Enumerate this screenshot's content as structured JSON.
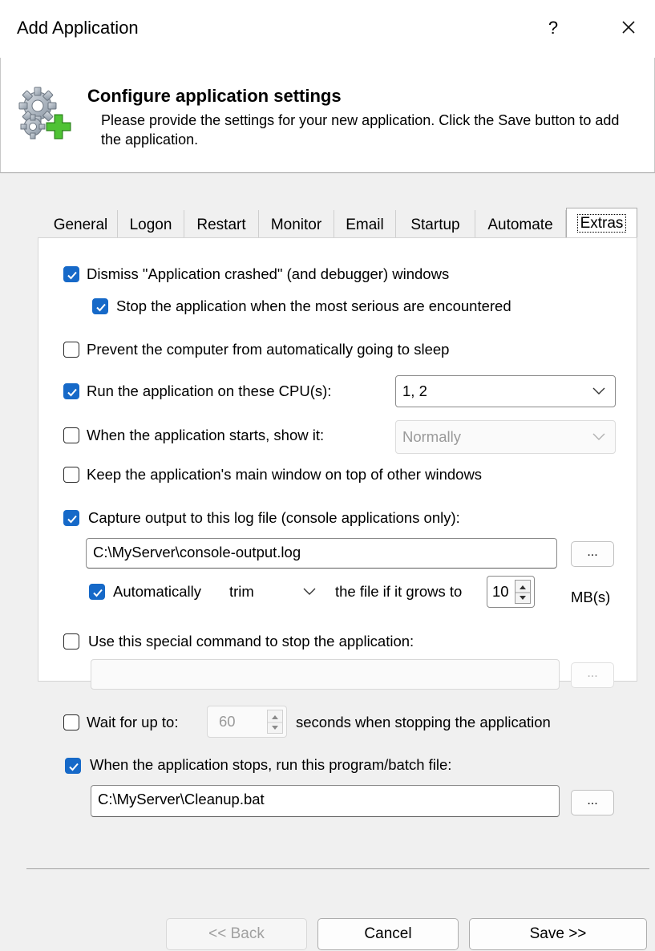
{
  "window": {
    "title": "Add Application",
    "help": "?",
    "close_icon": "close-icon"
  },
  "header": {
    "icon": "gears-add-icon",
    "title": "Configure application settings",
    "description": "Please provide the settings for your new application. Click the Save button to add the application."
  },
  "tabs": [
    "General",
    "Logon",
    "Restart",
    "Monitor",
    "Email",
    "Startup",
    "Automate",
    "Extras"
  ],
  "active_tab": "Extras",
  "options": {
    "dismiss_crashed": {
      "label": "Dismiss \"Application crashed\" (and debugger) windows",
      "checked": true
    },
    "stop_serious": {
      "label": "Stop the application when the most serious are encountered",
      "checked": true
    },
    "prevent_sleep": {
      "label": "Prevent the computer from automatically going to sleep",
      "checked": false
    },
    "run_cpus": {
      "label": "Run the application on these CPU(s):",
      "checked": true,
      "value": "1, 2"
    },
    "show_on_start": {
      "label": "When the application starts, show it:",
      "checked": false,
      "value": "Normally"
    },
    "keep_on_top": {
      "label": "Keep the application's main window on top of other windows",
      "checked": false
    },
    "capture_output": {
      "label": "Capture output to this log file (console applications only):",
      "checked": true,
      "path": "C:\\MyServer\\console-output.log",
      "browse": "..."
    },
    "auto_trim": {
      "label": "Automatically",
      "checked": true,
      "mode": "trim",
      "middle_text": "the file if it grows to",
      "size": "10",
      "unit": "MB(s)"
    },
    "special_stop": {
      "label": "Use this special command to stop the application:",
      "checked": false,
      "value": "",
      "browse": "..."
    },
    "wait_for": {
      "label": "Wait for up to:",
      "checked": false,
      "seconds": "60",
      "suffix": "seconds when stopping the application"
    },
    "run_on_stop": {
      "label": "When the application stops, run this program/batch file:",
      "checked": true,
      "path": "C:\\MyServer\\Cleanup.bat",
      "browse": "..."
    }
  },
  "buttons": {
    "back": "<< Back",
    "cancel": "Cancel",
    "save": "Save >>"
  },
  "colors": {
    "checkbox_accent": "#1669c8"
  }
}
